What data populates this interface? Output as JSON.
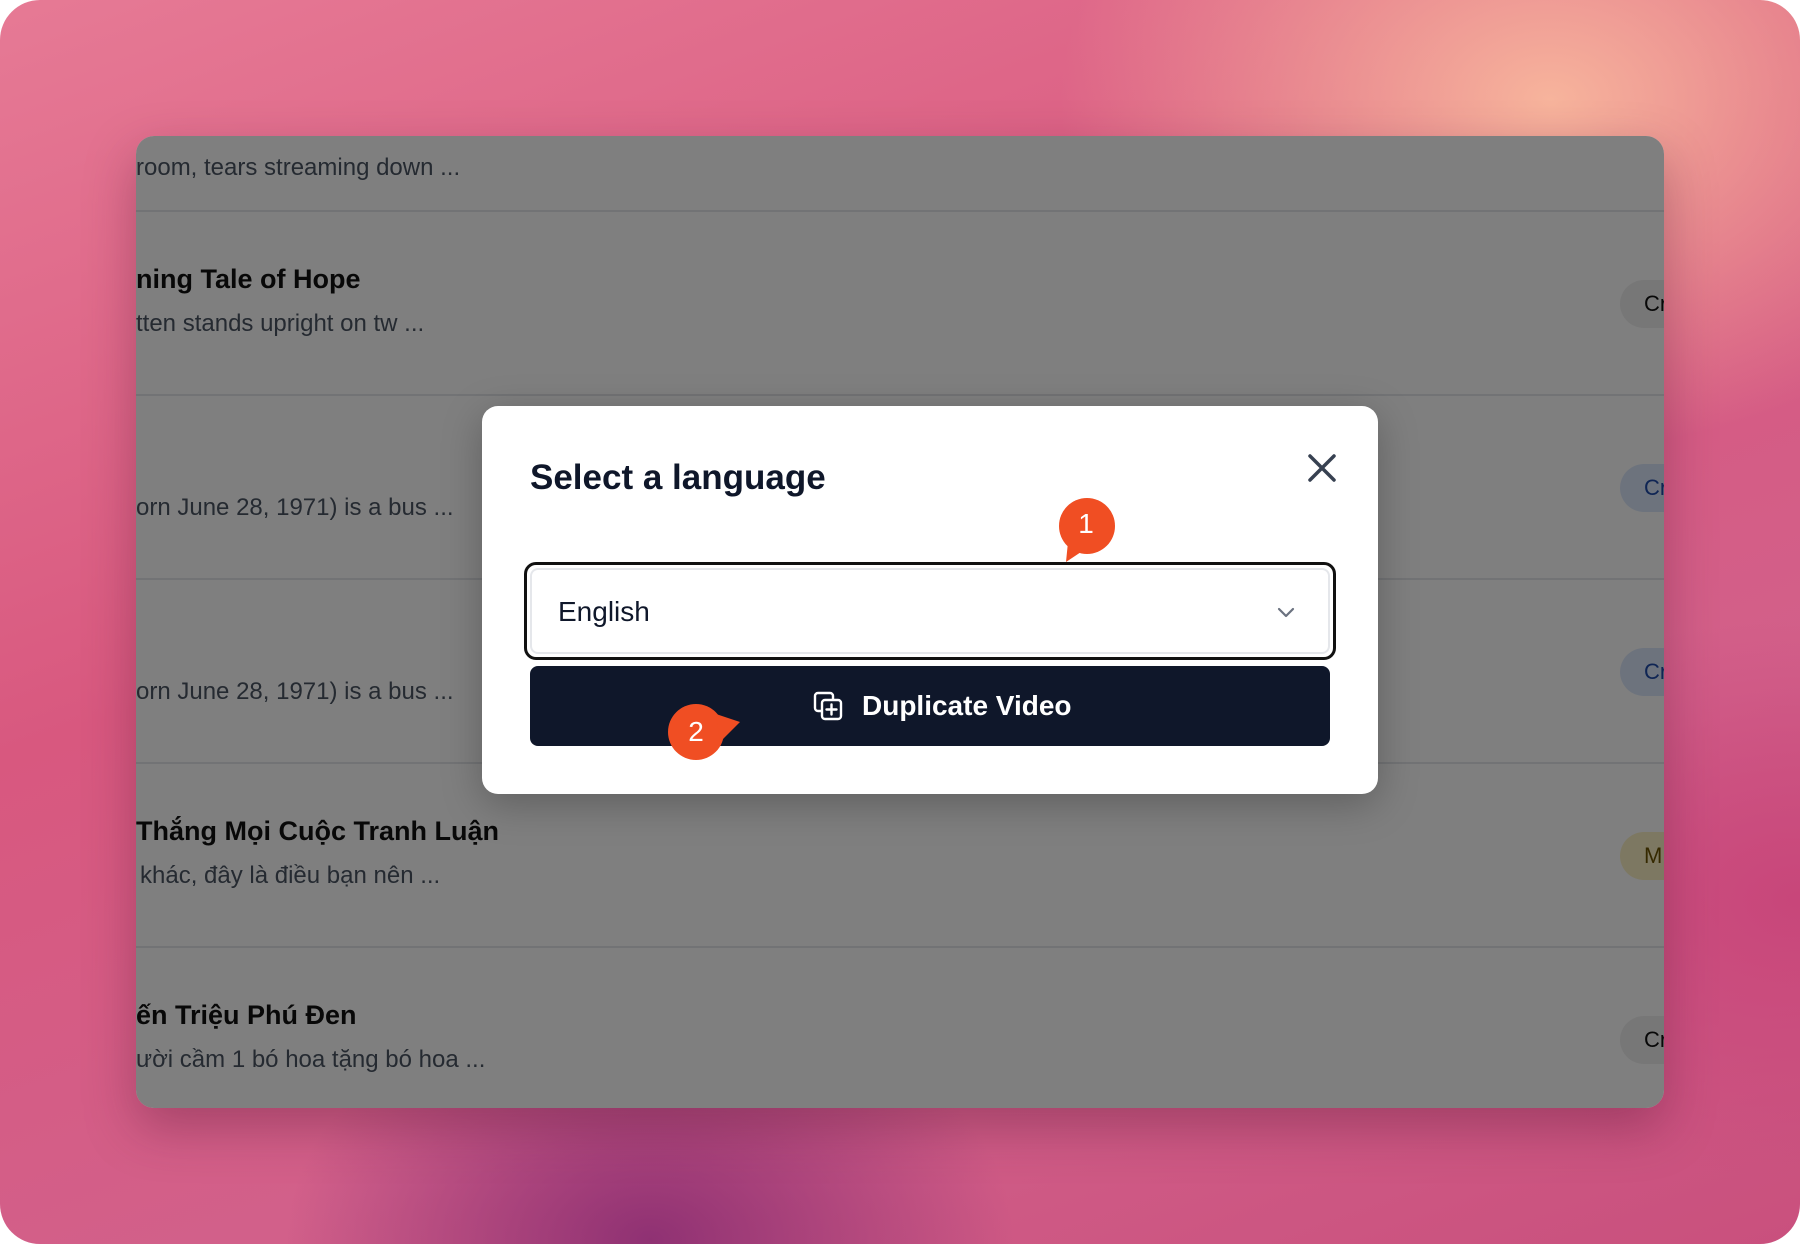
{
  "list": {
    "rows": [
      {
        "title": "",
        "desc": "room, tears streaming down ...",
        "badge": ""
      },
      {
        "title": "ning Tale of Hope",
        "desc": "tten stands upright on tw ...",
        "badge": "Cr"
      },
      {
        "title": "",
        "desc": "orn June 28, 1971) is a bus ...",
        "badge": "Cre"
      },
      {
        "title": "",
        "desc": "orn June 28, 1971) is a bus ...",
        "badge": "Cre"
      },
      {
        "title": "Thắng Mọi Cuộc Tranh Luận",
        "desc": "khác, đây là điều bạn nên ...",
        "badge": "M"
      },
      {
        "title": "ến Triệu Phú Đen",
        "desc": "ười cầm 1 bó hoa tặng bó hoa ...",
        "badge": "Cr"
      }
    ]
  },
  "modal": {
    "title": "Select a language",
    "close_icon": "close-icon",
    "language_select": {
      "value": "English",
      "icon": "chevron-down-icon"
    },
    "duplicate_button": {
      "label": "Duplicate Video",
      "icon": "duplicate-icon"
    }
  },
  "annotations": {
    "marker_1": "1",
    "marker_2": "2",
    "color": "#f04e23"
  },
  "colors": {
    "primary_button": "#0f172a",
    "overlay": "rgba(0,0,0,0.5)"
  }
}
